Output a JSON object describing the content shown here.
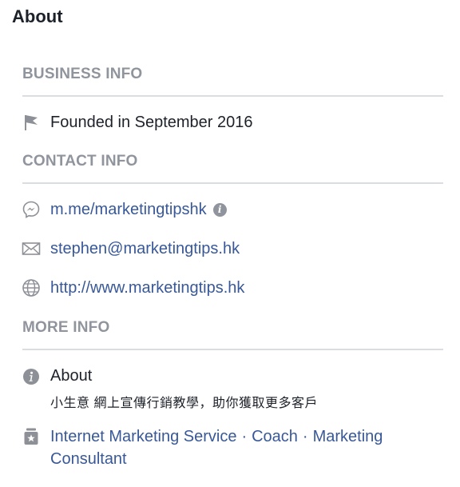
{
  "page": {
    "title": "About"
  },
  "business_info": {
    "header": "BUSINESS INFO",
    "founded": "Founded in September 2016"
  },
  "contact_info": {
    "header": "CONTACT INFO",
    "messenger": "m.me/marketingtipshk",
    "messenger_info_glyph": "i",
    "email": "stephen@marketingtips.hk",
    "website": "http://www.marketingtips.hk"
  },
  "more_info": {
    "header": "MORE INFO",
    "about_label": "About",
    "about_description": "小生意 網上宣傳行銷教學，助你獲取更多客戶",
    "categories": [
      "Internet Marketing Service",
      "Coach",
      "Marketing Consultant"
    ],
    "category_separator": "·"
  },
  "icons": {
    "founded": "flag-icon",
    "messenger": "messenger-icon",
    "email": "envelope-icon",
    "website": "globe-icon",
    "about": "info-icon",
    "category": "badge-star-icon"
  },
  "colors": {
    "link": "#385898",
    "header_gray": "#90949c",
    "divider": "#dadde1",
    "text": "#1d2129"
  }
}
